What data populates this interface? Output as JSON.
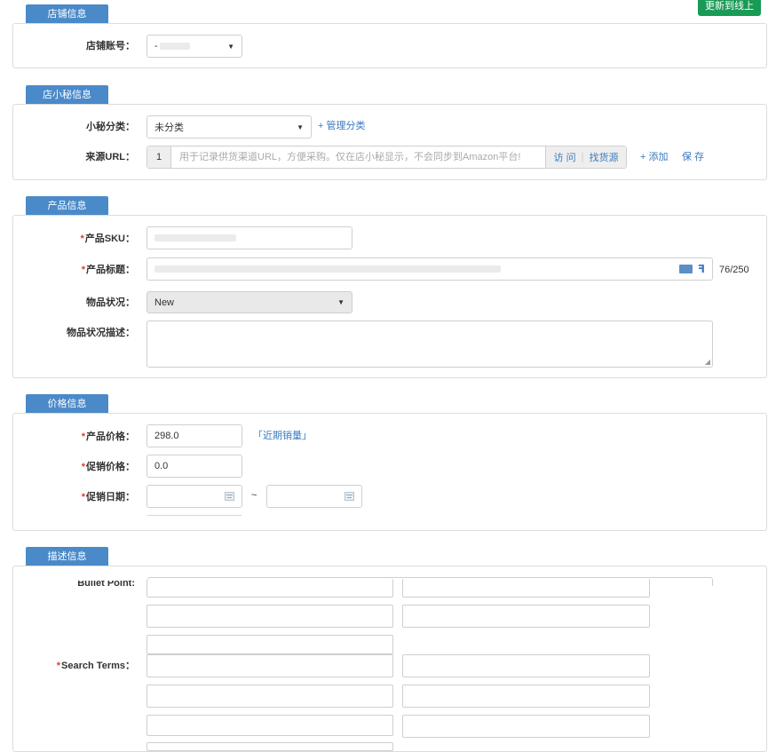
{
  "top_button": "更新到线上",
  "store": {
    "tab": "店铺信息",
    "account_label": "店铺账号：",
    "account_value": "-"
  },
  "assistant": {
    "tab": "店小秘信息",
    "category_label": "小秘分类：",
    "category_value": "未分类",
    "manage_link": "+ 管理分类",
    "source_label": "来源URL：",
    "source_index": "1",
    "source_placeholder": "用于记录供货渠道URL，方便采购。仅在店小秘显示，不会同步到Amazon平台!",
    "visit": "访 问",
    "find_source": "找货源",
    "add": "+ 添加",
    "save": "保 存"
  },
  "product": {
    "tab": "产品信息",
    "sku_label": "产品SKU：",
    "title_label": "产品标题：",
    "title_count": "76/250",
    "condition_label": "物品状况：",
    "condition_value": "New",
    "condition_desc_label": "物品状况描述："
  },
  "price": {
    "tab": "价格信息",
    "price_label": "产品价格：",
    "price_value": "298.0",
    "recent_sales": "「近期销量」",
    "promo_price_label": "促销价格：",
    "promo_price_value": "0.0",
    "promo_date_label": "促销日期：",
    "date_separator": "~"
  },
  "description": {
    "tab": "描述信息",
    "bullet_label": "Bullet Point:",
    "search_terms_label": "Search Terms："
  },
  "required_mark": "*",
  "colors": {
    "accent": "#4a8ac9",
    "green_button": "#199a55",
    "link": "#3a79bf",
    "required": "#e03a3a"
  }
}
